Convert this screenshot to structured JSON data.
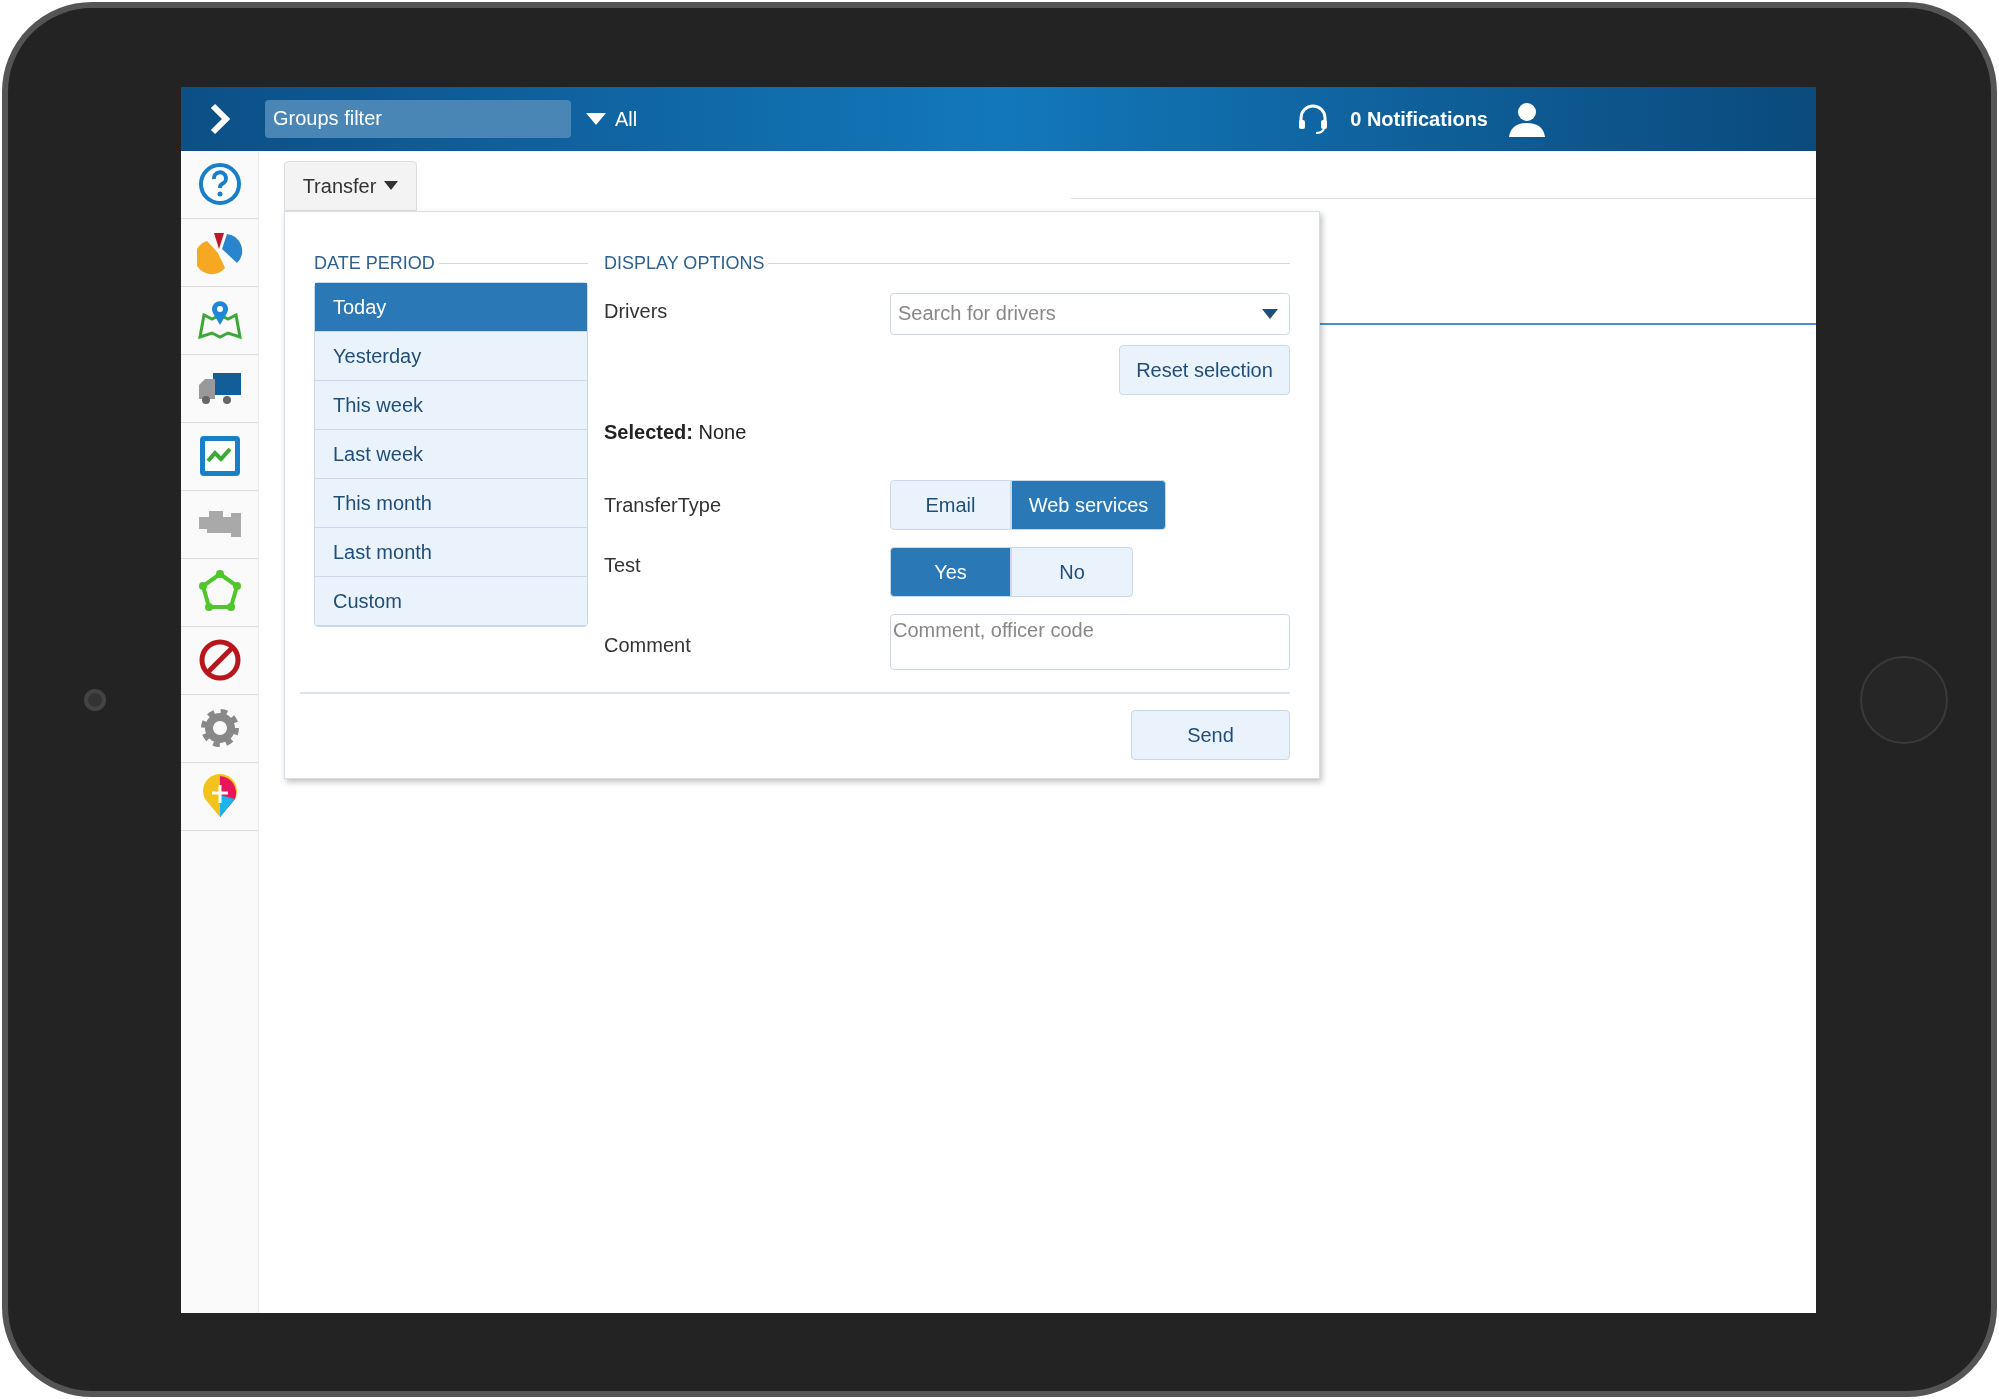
{
  "top_bar": {
    "groups_filter": {
      "placeholder": "Groups filter"
    },
    "scope": "All",
    "notifications": "0 Notifications"
  },
  "transfer_button": "Transfer",
  "date_period": {
    "title": "DATE PERIOD",
    "items": [
      {
        "label": "Today",
        "selected": true
      },
      {
        "label": "Yesterday",
        "selected": false
      },
      {
        "label": "This week",
        "selected": false
      },
      {
        "label": "Last week",
        "selected": false
      },
      {
        "label": "This month",
        "selected": false
      },
      {
        "label": "Last month",
        "selected": false
      },
      {
        "label": "Custom",
        "selected": false
      }
    ]
  },
  "display_options": {
    "title": "DISPLAY OPTIONS",
    "drivers": {
      "label": "Drivers",
      "placeholder": "Search for drivers"
    },
    "reset_button": "Reset selection",
    "selected_text": "**Selected:** None",
    "transfer_type": {
      "label": "TransferType",
      "options": [
        {
          "label": "Email",
          "selected": false
        },
        {
          "label": "Web services",
          "selected": true
        }
      ]
    },
    "test": {
      "label": "Test",
      "options": [
        {
          "label": "Yes",
          "selected": true
        },
        {
          "label": "No",
          "selected": false
        }
      ]
    },
    "comment": {
      "label": "Comment",
      "placeholder": "Comment, officer code"
    }
  },
  "send_button": "Send"
}
